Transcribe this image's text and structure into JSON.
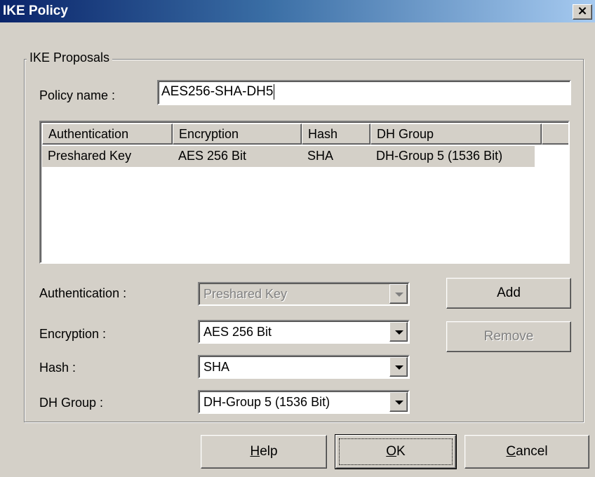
{
  "window": {
    "title": "IKE Policy",
    "close_glyph": "×"
  },
  "group": {
    "label": "IKE Proposals"
  },
  "policy": {
    "label": "Policy name :",
    "value": "AES256-SHA-DH5"
  },
  "proposal_list": {
    "columns": [
      "Authentication",
      "Encryption",
      "Hash",
      "DH Group",
      ""
    ],
    "rows": [
      {
        "authentication": "Preshared Key",
        "encryption": "AES 256 Bit",
        "hash": "SHA",
        "dh_group": "DH-Group 5 (1536 Bit)"
      }
    ]
  },
  "fields": {
    "authentication": {
      "label": "Authentication :",
      "value": "Preshared Key",
      "enabled": false
    },
    "encryption": {
      "label": "Encryption :",
      "value": "AES 256 Bit",
      "enabled": true
    },
    "hash": {
      "label": "Hash :",
      "value": "SHA",
      "enabled": true
    },
    "dh_group": {
      "label": "DH Group :",
      "value": "DH-Group 5 (1536 Bit)",
      "enabled": true
    }
  },
  "side_buttons": {
    "add": "Add",
    "remove": "Remove"
  },
  "footer_buttons": {
    "help": {
      "hotkey": "H",
      "rest": "elp"
    },
    "ok": {
      "hotkey": "O",
      "rest": "K"
    },
    "cancel": {
      "hotkey": "C",
      "rest": "ancel"
    }
  },
  "icons": {
    "close": "close-icon",
    "dropdown": "chevron-down-icon"
  },
  "colors": {
    "titlebar_start": "#0a246a",
    "titlebar_end": "#a6caf0",
    "face": "#d4d0c8"
  }
}
